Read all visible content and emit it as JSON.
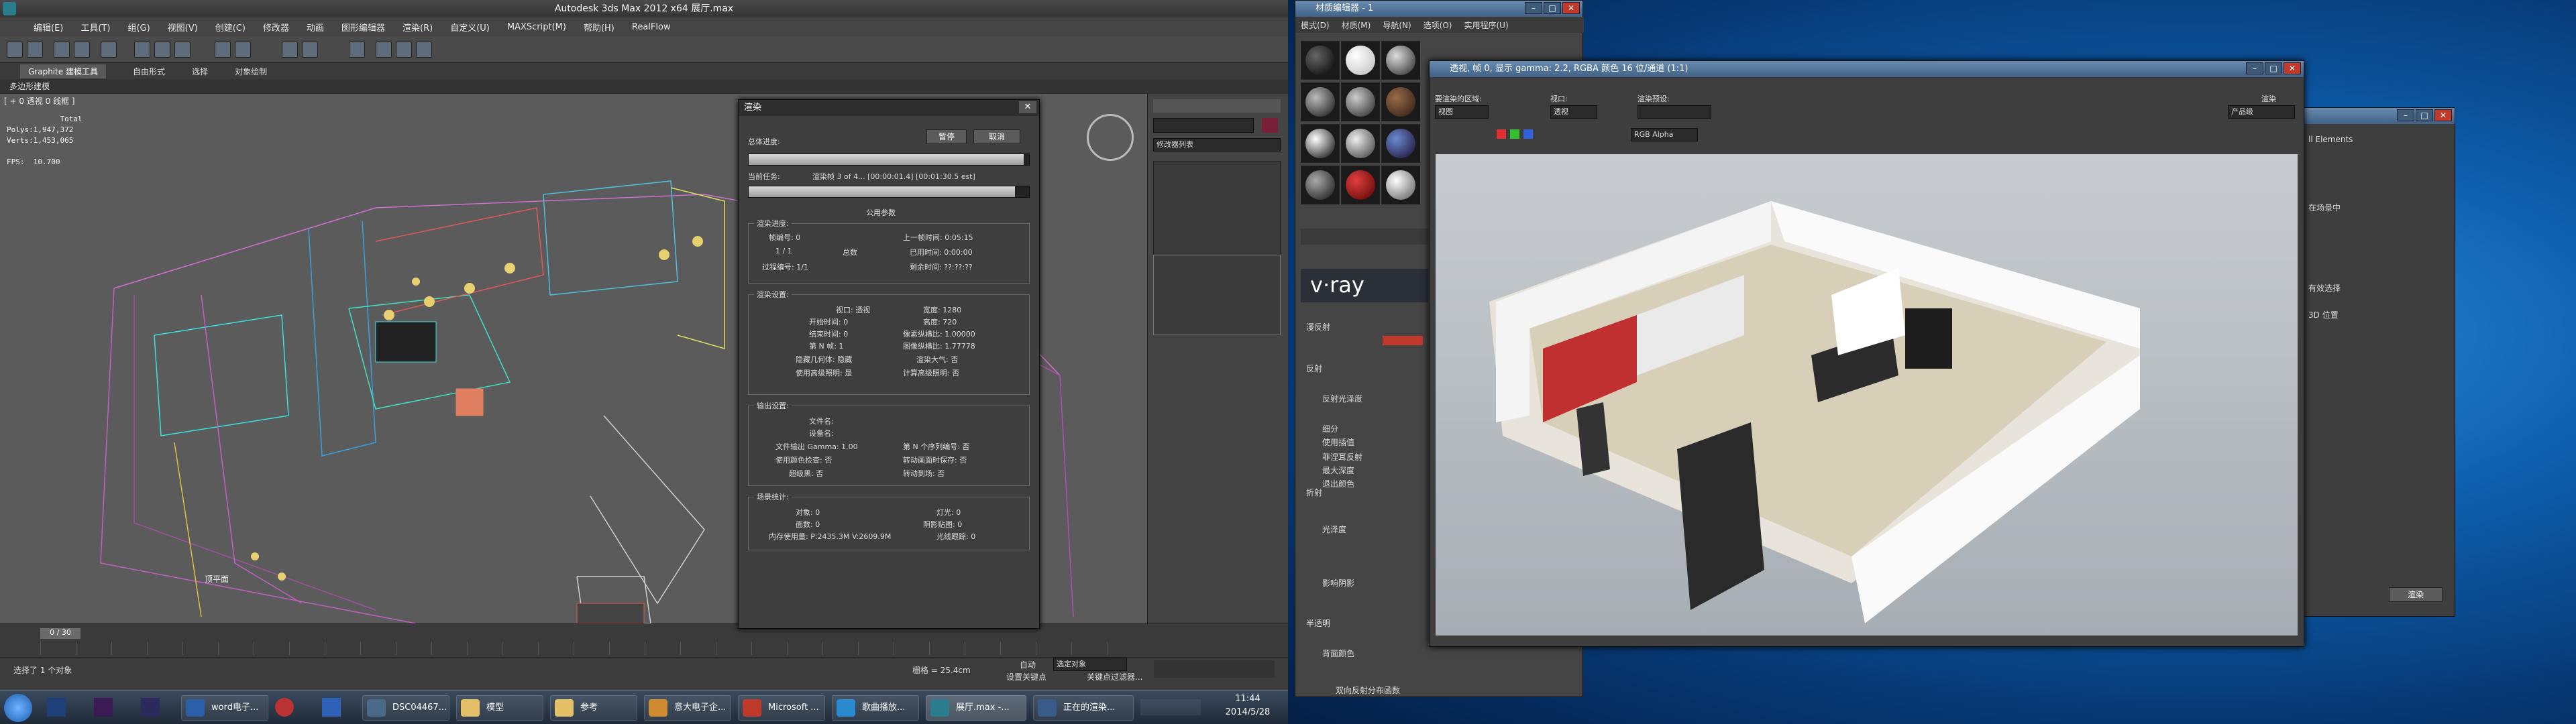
{
  "max": {
    "title": "Autodesk 3ds Max  2012 x64      展厅.max",
    "menu": [
      "编辑(E)",
      "工具(T)",
      "组(G)",
      "视图(V)",
      "创建(C)",
      "修改器",
      "动画",
      "图形编辑器",
      "渲染(R)",
      "自定义(U)",
      "MAXScript(M)",
      "帮助(H)",
      "RealFlow"
    ],
    "ribbon": {
      "active": "Graphite 建模工具",
      "tab2": "自由形式",
      "tab3": "选择",
      "tab4": "对象绘制"
    },
    "sub": "多边形建模",
    "viewport_label": "[ + 0 透视 0 线框 ]",
    "stats": "            Total\nPolys:1,947,372\nVerts:1,453,065\n\nFPS:  10.700",
    "floor_label": "顶平面",
    "time_slider": "0 / 30",
    "status_items": [
      "选择了 1 个对象",
      "栅格 = 25.4cm",
      "自动",
      "选定对象",
      "设置关键点",
      "关键点过滤器..."
    ],
    "cmd_label": "修改器列表"
  },
  "render_dialog": {
    "title": "渲染",
    "overall_label": "总体进度:",
    "pause": "暂停",
    "cancel": "取消",
    "current_task_label": "当前任务:",
    "current_task": "渲染帧 3 of 4... [00:00:01.4] [00:01:30.5 est]",
    "common_params": "公用参数",
    "progress": {
      "overall": 0.98,
      "current": 0.95
    },
    "g1": "渲染进度:",
    "frame_no": "帧编号:    0",
    "last_frame_time": "上一帧时间:  0:05:15",
    "frames": "1   /   1",
    "total": "总数",
    "elapsed": "已用时间:  0:00:00",
    "pass": "过程编号:   1/1",
    "remaining": "剩余时间: ??:??:??",
    "g2": "渲染设置:",
    "viewport": "视口: 透视",
    "width": "宽度: 1280",
    "start_frame": "开始时间: 0",
    "height": "高度: 720",
    "end_frame": "结束时间: 0",
    "pixel_aspect": "像素纵横比: 1.00000",
    "nth": "第 N 帧: 1",
    "image_aspect": "图像纵横比: 1.77778",
    "hide_geo": "隐藏几何体: 隐藏",
    "render_atmos": "渲染大气: 否",
    "use_adv": "使用高级照明: 是",
    "calc_adv": "计算高级照明: 否",
    "g3": "输出设置:",
    "file_name": "文件名:",
    "device": "设备名:",
    "gamma": "文件输出 Gamma: 1.00",
    "nth_serial": "第 N 个序列编号: 否",
    "virtual": "使用颜色检查: 否",
    "video_post": "转动画面时保存: 否",
    "super_black": "超级黑: 否",
    "render_to_fields": "转动到场: 否",
    "g4": "场景统计:",
    "objects": "对象: 0",
    "lights": "灯光: 0",
    "faces": "面数: 0",
    "shadow_lights": "阴影贴图: 0",
    "mem": "内存使用量: P:2435.3M V:2609.9M",
    "raytraced": "光线跟踪: 0"
  },
  "mat_editor": {
    "title": "材质编辑器 - 1",
    "menu": [
      "模式(D)",
      "材质(M)",
      "导航(N)",
      "选项(O)",
      "实用程序(U)"
    ],
    "vray": "v·ray",
    "rows": [
      "漫反射",
      "反射",
      "反射光泽度",
      "细分",
      "使用插值",
      "菲涅耳反射",
      "最大深度",
      "退出颜色",
      "折射",
      "光泽度",
      "影响阴影",
      "半透明",
      "背面颜色",
      "双向反射分布函数"
    ]
  },
  "framebuffer": {
    "title": "透视, 帧 0, 显示 gamma: 2.2, RGBA 颜色 16 位/通道 (1:1)",
    "area_label": "要渲染的区域:",
    "area_value": "视图",
    "viewport_label": "视口:",
    "viewport_value": "透视",
    "preset_label": "渲染预设:",
    "renderer_label": "渲染",
    "renderer_value": "产品级",
    "channel": "RGB Alpha"
  },
  "bg_window": {
    "items": [
      "ll Elements",
      "在场景中 ",
      "有效选择",
      "3D 位置 "
    ],
    "render": "渲染"
  },
  "taskbar": {
    "items": [
      "word电子...",
      "DSC04467...",
      "模型",
      "参考",
      "意大电子企...",
      "Microsoft ...",
      "歌曲播放...",
      "展厅.max -...",
      "正在的渲染..."
    ],
    "time": "11:44",
    "date": "2014/5/28"
  },
  "colors": {
    "accent": "#c0392b",
    "vray_bg": "#2a2f38"
  }
}
